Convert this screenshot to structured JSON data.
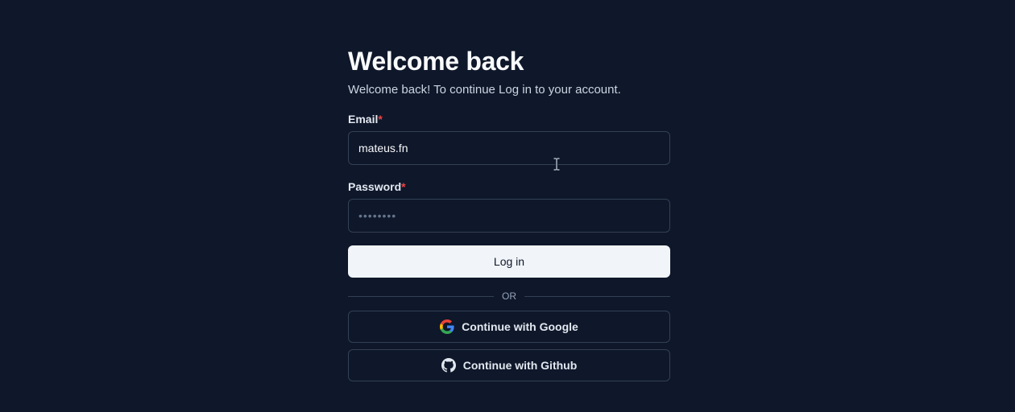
{
  "page": {
    "title": "Welcome back",
    "subtitle": "Welcome back! To continue Log in to your account."
  },
  "form": {
    "email": {
      "label": "Email",
      "required_mark": "*",
      "value": "mateus.fn"
    },
    "password": {
      "label": "Password",
      "required_mark": "*",
      "placeholder": "••••••••"
    },
    "login_label": "Log in",
    "divider_text": "OR",
    "google_label": "Continue with Google",
    "github_label": "Continue with Github"
  },
  "icons": {
    "google": "google-icon",
    "github": "github-icon",
    "cursor": "text-cursor-icon"
  },
  "colors": {
    "background": "#0f172a",
    "border": "#334155",
    "required": "#ef4444",
    "primary_button_bg": "#f1f5f9",
    "primary_button_text": "#0f172a"
  }
}
